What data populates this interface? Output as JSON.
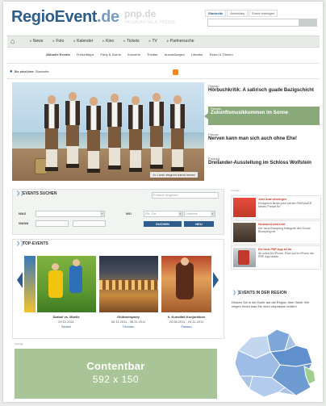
{
  "header": {
    "logo_main": "RegioEvent",
    "logo_tld": ".de",
    "partner_logo": "pnp.de",
    "partner_sub": "PASSAUER NEUE PRESSE",
    "user_links": [
      "Startseite",
      "Anmelden",
      "Event eintragen"
    ],
    "search_placeholder": ""
  },
  "main_nav": [
    "News",
    "Foto",
    "Kalender",
    "Kino",
    "Tickets",
    "TV",
    "Partnersuche"
  ],
  "sub_nav": {
    "active": "Aktuelle Events",
    "items": [
      "Freizeittipps",
      "Party & Szene",
      "Konzerte",
      "Theater",
      "Ausstellungen",
      "Literatur",
      "Essen & Trinken"
    ]
  },
  "location": {
    "label": "Sie sind hier:",
    "value": "Startseite"
  },
  "hero": {
    "caption": "Jo Lorsh beginnt damit immer"
  },
  "features": [
    {
      "kicker": "Passau",
      "headline": "Hörbuchkritik: A satirisch guade Bazigschicht"
    },
    {
      "kicker": "Passau",
      "headline": "Zukunftsmusikkommen im Sonne"
    },
    {
      "kicker": "Passau",
      "headline": "Nerven kann man sich auch ohne Ehe!"
    },
    {
      "kicker": "Freising",
      "headline": "Dreilander-Ausstellung im Schloss Wolfstein"
    }
  ],
  "event_search": {
    "title": "EVENTS SUCHEN",
    "freetext_placeholder": "Freitext eingeben",
    "was_label": "WAS",
    "wann_label": "WANN",
    "wo_label": "WO",
    "wann_from": "",
    "wann_to": "",
    "wo_value": "Plz, Ort",
    "umkreis_value": "Umkreis",
    "button_suchen": "SUCHEN",
    "button_neu": "NEU"
  },
  "top_events": {
    "title": "TOP-EVENTS",
    "items": [
      {
        "title": "Szabol vs. Muelle",
        "date": "29.10.2011",
        "place": "Szabol"
      },
      {
        "title": "Glühweinparty",
        "date": "05.11.2011 - 06.11.2011",
        "place": "Thurnau"
      },
      {
        "title": "X. Kunstfaß Konjunkture",
        "date": "20.08.2011 - 24.11.2011",
        "place": "Passau"
      }
    ]
  },
  "contentbar": {
    "label": "Anzeige",
    "line1": "Contentbar",
    "line2": "592 x 150"
  },
  "ads": {
    "label": "Anzeige",
    "items": [
      {
        "headline": "Jetzt Dual einsteigen",
        "text": "Erfolgreich lernen jetzt mit der PASSAUER Neuen Presse für"
      },
      {
        "headline": "Herbstzeit wird echt",
        "text": "Der neue Boxspring Kategorie den Sonne Boxspring mit"
      },
      {
        "headline": "Die neue PNP-App ist da",
        "text": "Ab sofort für iPhone, iPad und im iPhone die PNP-App testen"
      }
    ]
  },
  "region": {
    "title": "EVENTS IN DER REGION",
    "description": "Klicken Sie in der Karte auf die Region Ihrer Wahl. Wir zeigen Ihnen was Sie nicht verpassen dürfen!"
  },
  "colors": {
    "brand_blue": "#2d5d8c",
    "accent_green": "#8aa97b",
    "contentbar_green": "#a9c597"
  }
}
